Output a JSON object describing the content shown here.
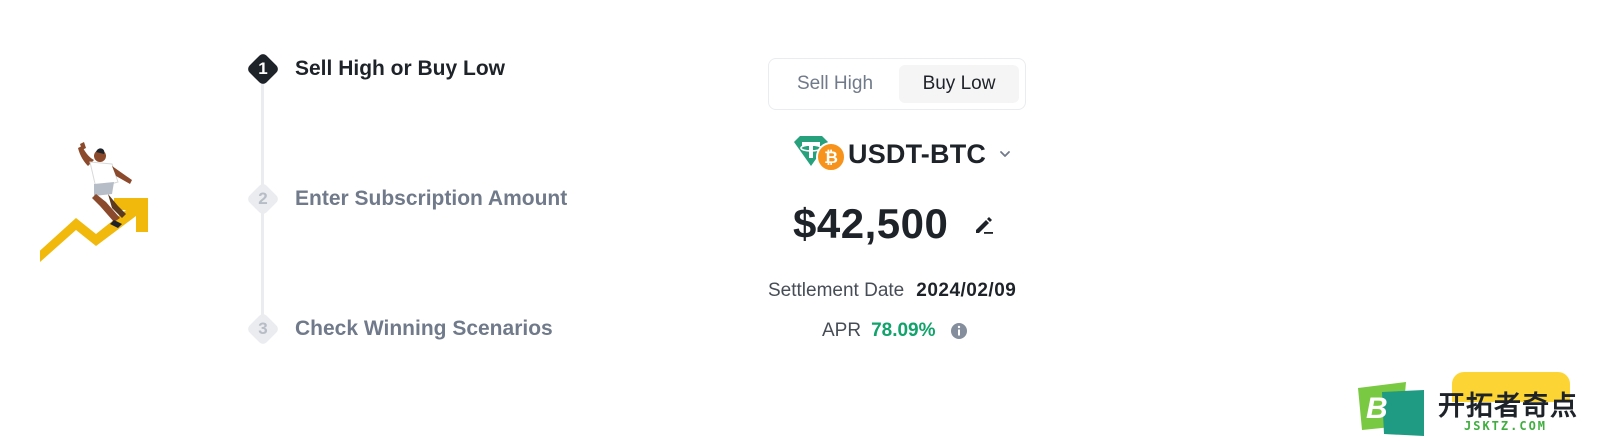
{
  "steps": [
    {
      "number": "1",
      "label": "Sell High or Buy Low",
      "state": "active"
    },
    {
      "number": "2",
      "label": "Enter Subscription Amount",
      "state": "inactive"
    },
    {
      "number": "3",
      "label": "Check Winning Scenarios",
      "state": "inactive"
    }
  ],
  "toggle": {
    "sell_high": "Sell High",
    "buy_low": "Buy Low",
    "selected": "Buy Low"
  },
  "pair": {
    "name": "USDT-BTC",
    "icons": [
      "tether-coin-icon",
      "bitcoin-coin-icon"
    ]
  },
  "price": {
    "amount": "$42,500"
  },
  "settlement": {
    "label": "Settlement Date",
    "value": "2024/02/09"
  },
  "apr": {
    "label": "APR",
    "value": "78.09%"
  },
  "watermark": {
    "title": "开拓者奇点",
    "subtitle": "JSKTZ.COM"
  },
  "colors": {
    "accent_yellow": "#fcd535",
    "positive_green": "#10a36b",
    "text_primary": "#1e2329",
    "text_secondary": "#707a8a",
    "tether_green": "#26a17b",
    "bitcoin_orange": "#f7931a"
  }
}
